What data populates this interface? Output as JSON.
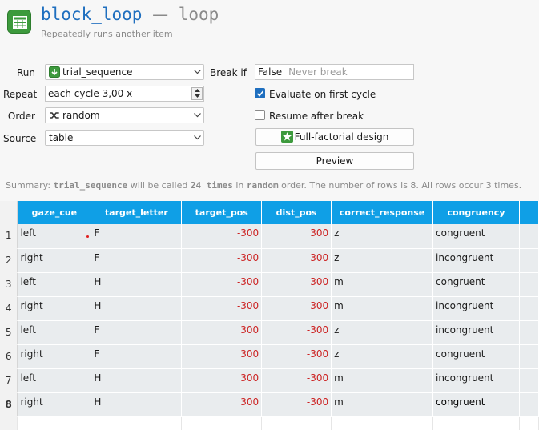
{
  "header": {
    "name": "block_loop",
    "separator": "—",
    "type": "loop",
    "subtitle": "Repeatedly runs another item",
    "icon": "table-grid-icon",
    "accent": "#1f6fbf",
    "icon_color": "#3d9a3d"
  },
  "form": {
    "run_label": "Run",
    "run_value": "trial_sequence",
    "repeat_label": "Repeat",
    "repeat_value": "each cycle 3,00 x",
    "order_label": "Order",
    "order_value": "random",
    "source_label": "Source",
    "source_value": "table",
    "break_if_label": "Break if",
    "break_if_value": "False",
    "break_if_placeholder": "Never break",
    "evaluate_first_label": "Evaluate on first cycle",
    "evaluate_first_checked": true,
    "resume_label": "Resume after break",
    "resume_checked": false,
    "fullfactorial_label": "Full-factorial design",
    "preview_label": "Preview"
  },
  "summary": {
    "prefix": "Summary: ",
    "item": "trial_sequence",
    "mid1": " will be called ",
    "times": "24 times",
    "mid2": " in ",
    "order": "random",
    "suffix": " order. The number of rows is 8. All rows occur 3 times."
  },
  "table": {
    "header_color": "#0f9fe6",
    "columns": [
      "gaze_cue",
      "target_letter",
      "target_pos",
      "dist_pos",
      "correct_response",
      "congruency"
    ],
    "row_numbers": [
      "1",
      "2",
      "3",
      "4",
      "5",
      "6",
      "7",
      "8"
    ],
    "rows": [
      [
        "left",
        "F",
        "-300",
        "300",
        "z",
        "congruent"
      ],
      [
        "right",
        "F",
        "-300",
        "300",
        "z",
        "incongruent"
      ],
      [
        "left",
        "H",
        "-300",
        "300",
        "m",
        "congruent"
      ],
      [
        "right",
        "H",
        "-300",
        "300",
        "m",
        "incongruent"
      ],
      [
        "left",
        "F",
        "300",
        "-300",
        "z",
        "incongruent"
      ],
      [
        "right",
        "F",
        "300",
        "-300",
        "z",
        "congruent"
      ],
      [
        "left",
        "H",
        "300",
        "-300",
        "m",
        "incongruent"
      ],
      [
        "right",
        "H",
        "300",
        "-300",
        "m",
        "congruent"
      ]
    ],
    "numeric_color": "#cc2222"
  }
}
